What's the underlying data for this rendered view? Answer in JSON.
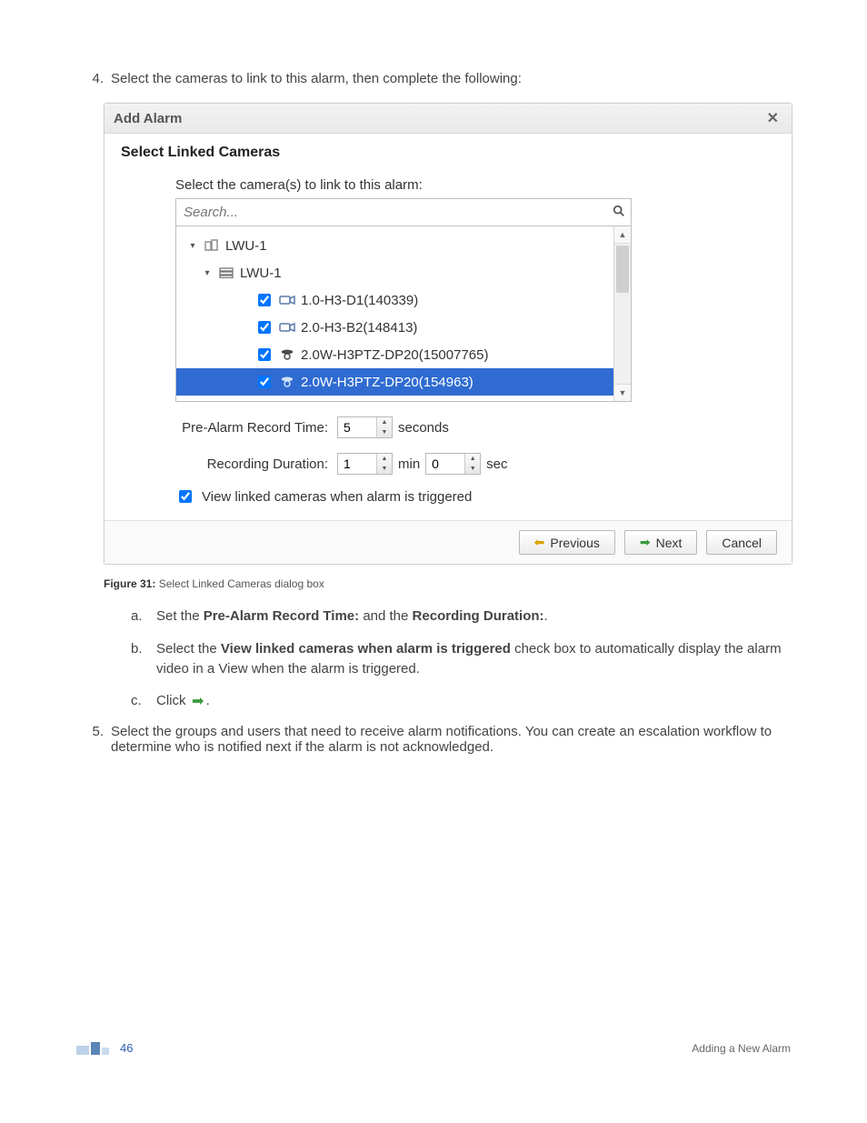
{
  "step4": {
    "number": "4.",
    "text": "Select the cameras to link to this alarm, then complete the following:"
  },
  "dialog": {
    "title": "Add Alarm",
    "section_title": "Select Linked Cameras",
    "instruction": "Select the camera(s) to link to this alarm:",
    "search_placeholder": "Search...",
    "tree": {
      "root": "LWU-1",
      "group": "LWU-1",
      "items": [
        {
          "label": "1.0-H3-D1(140339)",
          "checked": true,
          "ptz": false
        },
        {
          "label": "2.0-H3-B2(148413)",
          "checked": true,
          "ptz": false
        },
        {
          "label": "2.0W-H3PTZ-DP20(15007765)",
          "checked": true,
          "ptz": true
        },
        {
          "label": "2.0W-H3PTZ-DP20(154963)",
          "checked": true,
          "ptz": true,
          "selected": true
        }
      ]
    },
    "prealarm": {
      "label": "Pre-Alarm Record Time:",
      "value": "5",
      "unit": "seconds"
    },
    "recdur": {
      "label": "Recording Duration:",
      "min_value": "1",
      "min_unit": "min",
      "sec_value": "0",
      "sec_unit": "sec"
    },
    "view_linked": {
      "checked": true,
      "label": "View linked cameras when alarm is triggered"
    },
    "buttons": {
      "previous": "Previous",
      "next": "Next",
      "cancel": "Cancel"
    }
  },
  "figure": {
    "label": "Figure 31:",
    "text": "Select Linked Cameras dialog box"
  },
  "substeps": {
    "a": {
      "marker": "a.",
      "pre": "Set the ",
      "bold1": "Pre-Alarm Record Time:",
      "mid": " and the ",
      "bold2": "Recording Duration:",
      "post": "."
    },
    "b": {
      "marker": "b.",
      "pre": "Select the ",
      "bold": "View linked cameras when alarm is triggered",
      "post": " check box to automatically display the alarm video in a View when the alarm is triggered."
    },
    "c": {
      "marker": "c.",
      "pre": "Click ",
      "post": "."
    }
  },
  "step5": {
    "number": "5.",
    "text": "Select the groups and users that need to receive alarm notifications. You can create an escalation workflow to determine who is notified next if the alarm is not acknowledged."
  },
  "footer": {
    "page": "46",
    "right": "Adding a New Alarm"
  }
}
